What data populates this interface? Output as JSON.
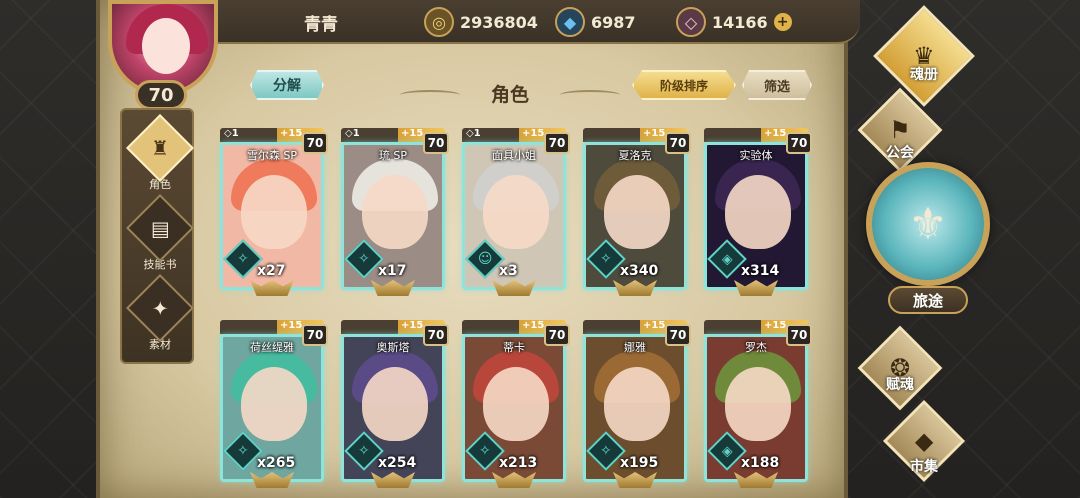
{
  "player": {
    "name": "青青",
    "level": "70"
  },
  "currencies": [
    {
      "icon": "gold-coin-icon",
      "glyph": "◎",
      "value": "2936804",
      "color": "#c9a25a"
    },
    {
      "icon": "blue-crystal-icon",
      "glyph": "◆",
      "value": "6987",
      "color": "#4aa6e0"
    },
    {
      "icon": "pink-gem-icon",
      "glyph": "◇",
      "value": "14166",
      "color": "#e7b6c8"
    }
  ],
  "plus_label": "+",
  "left_nav": [
    {
      "label": "角色",
      "glyph": "♜",
      "active": true
    },
    {
      "label": "技能书",
      "glyph": "▤",
      "active": false
    },
    {
      "label": "素材",
      "glyph": "✦",
      "active": false
    }
  ],
  "header": {
    "decompose_label": "分解",
    "title": "角色",
    "sort_label": "阶级排序",
    "filter_label": "筛选"
  },
  "characters": [
    {
      "name": "雪尔森 SP",
      "rank": "◇1",
      "plus": "+15",
      "level": "70",
      "count": "x27",
      "hair": "#ef7a5c",
      "bg": "#f1b9a5",
      "element": "✧"
    },
    {
      "name": "琉 SP",
      "rank": "◇1",
      "plus": "+15",
      "level": "70",
      "count": "x17",
      "hair": "#e6e2dc",
      "bg": "#9b8d86",
      "element": "✧"
    },
    {
      "name": "面具小姐",
      "rank": "◇1",
      "plus": "+15",
      "level": "70",
      "count": "x3",
      "hair": "#d0cfcc",
      "bg": "#cfc6b6",
      "element": "☺"
    },
    {
      "name": "夏洛克",
      "rank": "",
      "plus": "+15",
      "level": "70",
      "count": "x340",
      "hair": "#6e5b3a",
      "bg": "#4e4a3c",
      "element": "✧"
    },
    {
      "name": "实验体",
      "rank": "",
      "plus": "+15",
      "level": "70",
      "count": "x314",
      "hair": "#3a2450",
      "bg": "#221833",
      "element": "◈"
    },
    {
      "name": "荷丝缇雅",
      "rank": "",
      "plus": "+15",
      "level": "70",
      "count": "x265",
      "hair": "#46bba0",
      "bg": "#6fa7a0",
      "element": "✧"
    },
    {
      "name": "奥斯塔",
      "rank": "",
      "plus": "+15",
      "level": "70",
      "count": "x254",
      "hair": "#5a4a86",
      "bg": "#434458",
      "element": "✧"
    },
    {
      "name": "蒂卡",
      "rank": "",
      "plus": "+15",
      "level": "70",
      "count": "x213",
      "hair": "#b8463a",
      "bg": "#7b4a36",
      "element": "✧"
    },
    {
      "name": "娜雅",
      "rank": "",
      "plus": "+15",
      "level": "70",
      "count": "x195",
      "hair": "#9b6a34",
      "bg": "#6c4e2e",
      "element": "✧"
    },
    {
      "name": "罗杰",
      "rank": "",
      "plus": "+15",
      "level": "70",
      "count": "x188",
      "hair": "#6f8a3a",
      "bg": "#7a3c30",
      "element": "◈"
    }
  ],
  "right_nav": {
    "soul_book": "魂册",
    "guild": "公会",
    "journey": "旅途",
    "soul_gift": "赋魂",
    "market": "市集"
  }
}
